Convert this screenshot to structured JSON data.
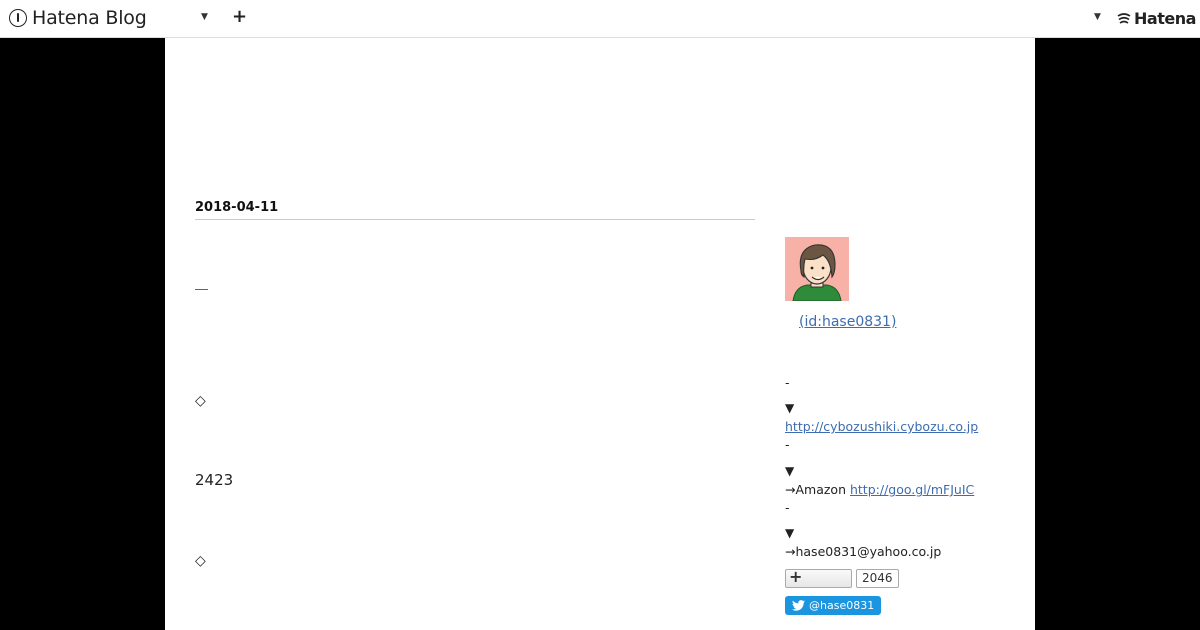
{
  "topbar": {
    "brand": "Hatena Blog",
    "add_symbol": "+",
    "hatena_label": "Hatena"
  },
  "entry": {
    "date": "2018-04-11",
    "diamond_1": "◇",
    "count": "2423",
    "diamond_2": "◇"
  },
  "sidebar": {
    "profile_id": "(id:hase0831)",
    "dash_1": "-",
    "triangle_1": "▼",
    "link_1": "http://cybozushiki.cybozu.co.jp",
    "dash_2": "-",
    "triangle_2": "▼",
    "amazon_prefix": "→Amazon",
    "link_2": "http://goo.gl/mFJuIC",
    "dash_3": "-",
    "triangle_3": "▼",
    "email": "→hase0831@yahoo.co.jp",
    "star_count": "2046",
    "twitter_label": "@hase0831"
  },
  "colors": {
    "link": "#3d6cb0",
    "twitter": "#1b95e0",
    "avatar_bg": "#f7b1a6"
  }
}
